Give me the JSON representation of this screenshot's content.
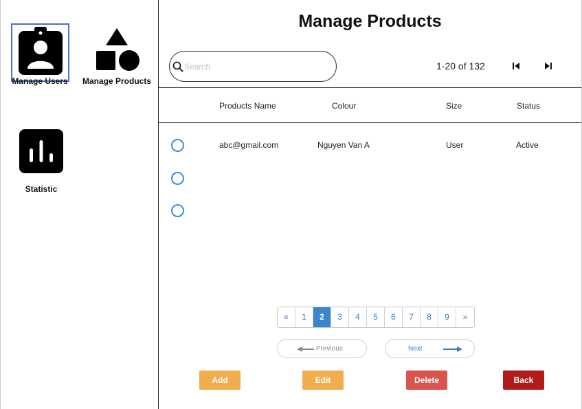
{
  "sidebar": {
    "items": [
      {
        "label": "Manage Users",
        "icon": "user-badge-icon",
        "selected": true
      },
      {
        "label": "Manage Products",
        "icon": "shapes-icon"
      },
      {
        "label": "Statistic",
        "icon": "bar-chart-icon"
      }
    ]
  },
  "header": {
    "title": "Manage Products"
  },
  "search": {
    "placeholder": "Search",
    "value": ""
  },
  "paging_info": {
    "range": "1-20 of 132"
  },
  "table": {
    "columns": [
      "Products Name",
      "Colour",
      "Size",
      "Status"
    ],
    "rows": [
      {
        "name": "abc@gmail.com",
        "colour": "Nguyen Van A",
        "size": "User",
        "status": "Active"
      },
      {
        "name": "",
        "colour": "",
        "size": "",
        "status": ""
      },
      {
        "name": "",
        "colour": "",
        "size": "",
        "status": ""
      }
    ]
  },
  "pagination": {
    "prev": "«",
    "pages": [
      "1",
      "2",
      "3",
      "4",
      "5",
      "6",
      "7",
      "8",
      "9"
    ],
    "current": "2",
    "next": "»"
  },
  "nav_buttons": {
    "previous": "Previous",
    "next": "Next"
  },
  "actions": {
    "add": "Add",
    "edit": "Edit",
    "delete": "Delete",
    "back": "Back"
  },
  "colors": {
    "selection_border": "#4a6fd1",
    "radio": "#3a8fe0",
    "page_active": "#3a85cc",
    "add": "#f0ad4e",
    "edit": "#f0ad4e",
    "delete": "#d9534f",
    "back": "#b31b1b"
  }
}
